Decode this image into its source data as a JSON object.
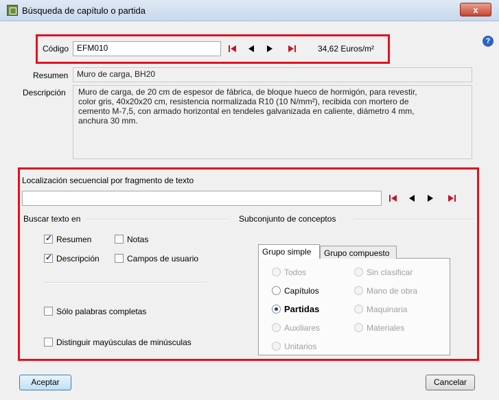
{
  "window": {
    "title": "Búsqueda de capítulo o partida",
    "close": "x",
    "help": "?"
  },
  "top": {
    "code_label": "Código",
    "code_value": "EFM010",
    "price": "34,62 Euros/m²",
    "resumen_label": "Resumen",
    "resumen_value": "Muro de carga, BH20",
    "descripcion_label": "Descripción",
    "descripcion_lines": [
      "Muro de carga, de 20 cm de espesor de fábrica, de bloque hueco de hormigón, para revestir,",
      "color gris, 40x20x20 cm, resistencia normalizada R10 (10 N/mm²), recibida con mortero de",
      "cemento M-7,5, con armado horizontal en tendeles galvanizada en caliente, diámetro 4 mm,",
      "anchura 30 mm."
    ]
  },
  "search": {
    "heading": "Localización secuencial por fragmento de texto",
    "input_value": "",
    "buscar_heading": "Buscar texto en",
    "resumen": "Resumen",
    "notas": "Notas",
    "descripcion": "Descripción",
    "campos": "Campos de usuario",
    "solo_palabras": "Sólo palabras completas",
    "distinguir": "Distinguir mayúsculas de minúsculas",
    "subconjunto_heading": "Subconjunto de conceptos",
    "tab_simple": "Grupo simple",
    "tab_compuesto": "Grupo compuesto",
    "options": {
      "todos": "Todos",
      "sin_clasificar": "Sin clasificar",
      "capitulos": "Capítulos",
      "mano_obra": "Mano de obra",
      "partidas": "Partidas",
      "maquinaria": "Maquinaria",
      "auxiliares": "Auxiliares",
      "materiales": "Materiales",
      "unitarios": "Unitarios"
    }
  },
  "buttons": {
    "aceptar": "Aceptar",
    "cancelar": "Cancelar"
  },
  "colors": {
    "highlight": "#e2101e",
    "nav": "#c0172a"
  }
}
